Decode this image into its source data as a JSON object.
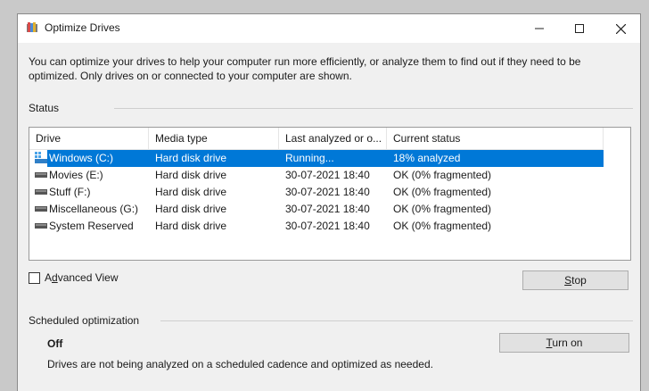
{
  "window": {
    "title": "Optimize Drives"
  },
  "description": "You can optimize your drives to help your computer run more efficiently, or analyze them to find out if they need to be optimized. Only drives on or connected to your computer are shown.",
  "status_section": {
    "label": "Status",
    "columns": [
      "Drive",
      "Media type",
      "Last analyzed or o...",
      "Current status"
    ],
    "rows": [
      {
        "drive": "Windows (C:)",
        "media": "Hard disk drive",
        "last": "Running...",
        "status": "18% analyzed",
        "selected": true
      },
      {
        "drive": "Movies (E:)",
        "media": "Hard disk drive",
        "last": "30-07-2021 18:40",
        "status": "OK (0% fragmented)"
      },
      {
        "drive": "Stuff (F:)",
        "media": "Hard disk drive",
        "last": "30-07-2021 18:40",
        "status": "OK (0% fragmented)"
      },
      {
        "drive": "Miscellaneous (G:)",
        "media": "Hard disk drive",
        "last": "30-07-2021 18:40",
        "status": "OK (0% fragmented)"
      },
      {
        "drive": "System Reserved",
        "media": "Hard disk drive",
        "last": "30-07-2021 18:40",
        "status": "OK (0% fragmented)"
      }
    ]
  },
  "advanced_view": {
    "pre": "A",
    "accel": "d",
    "post": "vanced View",
    "checked": false
  },
  "stop_button": {
    "accel": "S",
    "rest": "top"
  },
  "scheduled": {
    "label": "Scheduled optimization",
    "state": "Off",
    "description": "Drives are not being analyzed on a scheduled cadence and optimized as needed.",
    "button_accel": "T",
    "button_rest": "urn on"
  },
  "colors": {
    "selection": "#0078d7",
    "window_bg": "#f0f0f0"
  }
}
